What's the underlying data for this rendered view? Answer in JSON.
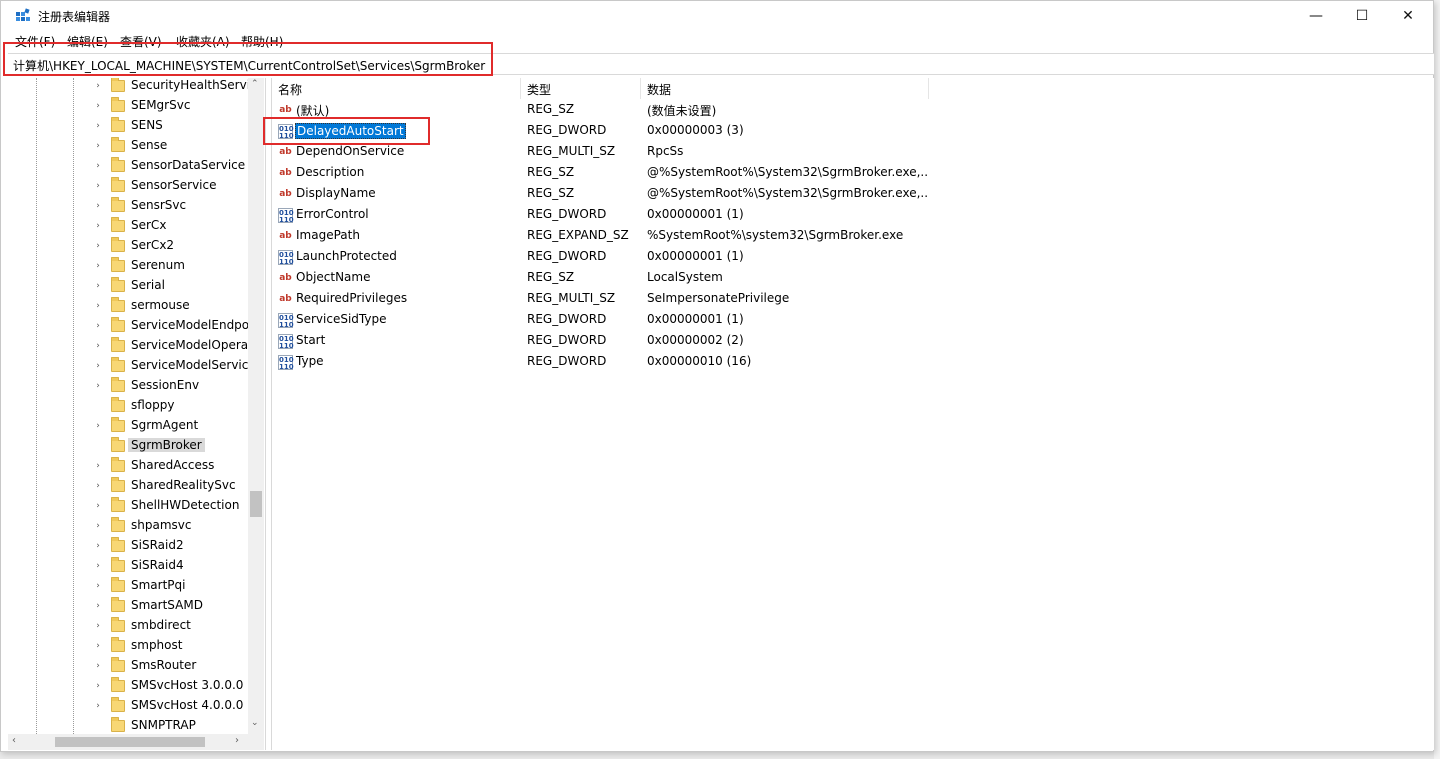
{
  "window": {
    "title": "注册表编辑器",
    "minimize_glyph": "—",
    "maximize_glyph": "☐",
    "close_glyph": "✕"
  },
  "menu": [
    "文件(F)",
    "编辑(E)",
    "查看(V)",
    "收藏夹(A)",
    "帮助(H)"
  ],
  "address": "计算机\\HKEY_LOCAL_MACHINE\\SYSTEM\\CurrentControlSet\\Services\\SgrmBroker",
  "tree": {
    "items": [
      {
        "label": "SecurityHealthServic",
        "expandable": true
      },
      {
        "label": "SEMgrSvc",
        "expandable": true
      },
      {
        "label": "SENS",
        "expandable": true
      },
      {
        "label": "Sense",
        "expandable": true
      },
      {
        "label": "SensorDataService",
        "expandable": true
      },
      {
        "label": "SensorService",
        "expandable": true
      },
      {
        "label": "SensrSvc",
        "expandable": true
      },
      {
        "label": "SerCx",
        "expandable": true
      },
      {
        "label": "SerCx2",
        "expandable": true
      },
      {
        "label": "Serenum",
        "expandable": true
      },
      {
        "label": "Serial",
        "expandable": true
      },
      {
        "label": "sermouse",
        "expandable": true
      },
      {
        "label": "ServiceModelEndpo",
        "expandable": true
      },
      {
        "label": "ServiceModelOpera",
        "expandable": true
      },
      {
        "label": "ServiceModelService",
        "expandable": true
      },
      {
        "label": "SessionEnv",
        "expandable": true
      },
      {
        "label": "sfloppy",
        "expandable": false
      },
      {
        "label": "SgrmAgent",
        "expandable": true
      },
      {
        "label": "SgrmBroker",
        "expandable": false,
        "selected": true
      },
      {
        "label": "SharedAccess",
        "expandable": true
      },
      {
        "label": "SharedRealitySvc",
        "expandable": true
      },
      {
        "label": "ShellHWDetection",
        "expandable": true
      },
      {
        "label": "shpamsvc",
        "expandable": true
      },
      {
        "label": "SiSRaid2",
        "expandable": true
      },
      {
        "label": "SiSRaid4",
        "expandable": true
      },
      {
        "label": "SmartPqi",
        "expandable": true
      },
      {
        "label": "SmartSAMD",
        "expandable": true
      },
      {
        "label": "smbdirect",
        "expandable": true
      },
      {
        "label": "smphost",
        "expandable": true
      },
      {
        "label": "SmsRouter",
        "expandable": true
      },
      {
        "label": "SMSvcHost 3.0.0.0",
        "expandable": true
      },
      {
        "label": "SMSvcHost 4.0.0.0",
        "expandable": true
      },
      {
        "label": "SNMPTRAP",
        "expandable": false
      }
    ]
  },
  "list": {
    "headers": {
      "name": "名称",
      "type": "类型",
      "data": "数据"
    },
    "rows": [
      {
        "icon": "ab",
        "name": "(默认)",
        "type": "REG_SZ",
        "data": "(数值未设置)"
      },
      {
        "icon": "bin",
        "name": "DelayedAutoStart",
        "type": "REG_DWORD",
        "data": "0x00000003 (3)",
        "selected": true
      },
      {
        "icon": "ab",
        "name": "DependOnService",
        "type": "REG_MULTI_SZ",
        "data": "RpcSs"
      },
      {
        "icon": "ab",
        "name": "Description",
        "type": "REG_SZ",
        "data": "@%SystemRoot%\\System32\\SgrmBroker.exe,..."
      },
      {
        "icon": "ab",
        "name": "DisplayName",
        "type": "REG_SZ",
        "data": "@%SystemRoot%\\System32\\SgrmBroker.exe,..."
      },
      {
        "icon": "bin",
        "name": "ErrorControl",
        "type": "REG_DWORD",
        "data": "0x00000001 (1)"
      },
      {
        "icon": "ab",
        "name": "ImagePath",
        "type": "REG_EXPAND_SZ",
        "data": "%SystemRoot%\\system32\\SgrmBroker.exe"
      },
      {
        "icon": "bin",
        "name": "LaunchProtected",
        "type": "REG_DWORD",
        "data": "0x00000001 (1)"
      },
      {
        "icon": "ab",
        "name": "ObjectName",
        "type": "REG_SZ",
        "data": "LocalSystem"
      },
      {
        "icon": "ab",
        "name": "RequiredPrivileges",
        "type": "REG_MULTI_SZ",
        "data": "SeImpersonatePrivilege"
      },
      {
        "icon": "bin",
        "name": "ServiceSidType",
        "type": "REG_DWORD",
        "data": "0x00000001 (1)"
      },
      {
        "icon": "bin",
        "name": "Start",
        "type": "REG_DWORD",
        "data": "0x00000002 (2)"
      },
      {
        "icon": "bin",
        "name": "Type",
        "type": "REG_DWORD",
        "data": "0x00000010 (16)"
      }
    ]
  },
  "icons": {
    "string_value": "ab",
    "binary_value": "010\n110",
    "expand_arrow": "›",
    "scroll_up": "⌃",
    "scroll_down": "⌄",
    "scroll_left": "‹",
    "scroll_right": "›"
  },
  "colors": {
    "selection": "#0078d7",
    "highlight_box": "#e02b2b",
    "folder": "#f8d775"
  }
}
